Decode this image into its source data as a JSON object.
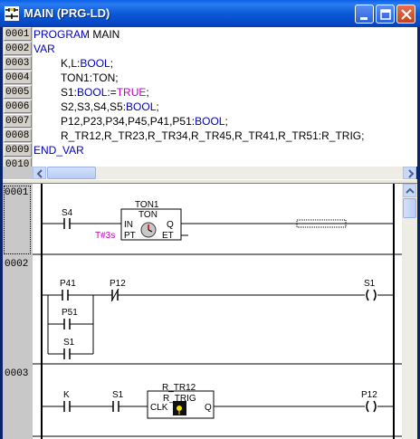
{
  "window": {
    "title": "MAIN (PRG-LD)"
  },
  "declarations": {
    "line_numbers": [
      "0001",
      "0002",
      "0003",
      "0004",
      "0005",
      "0006",
      "0007",
      "0008",
      "0009",
      "0010"
    ],
    "lines": [
      {
        "kw": "PROGRAM",
        "text": " MAIN",
        "mag": ""
      },
      {
        "kw": "VAR",
        "text": "",
        "mag": ""
      },
      {
        "kw": "",
        "text": "K,L:",
        "kw2": "BOOL",
        "tail": ";"
      },
      {
        "kw": "",
        "text": "TON1:TON;"
      },
      {
        "kw": "",
        "text": "S1:",
        "kw2": "BOOL",
        "tail": ":=",
        "mag": "TRUE",
        "tail2": ";"
      },
      {
        "kw": "",
        "text": "S2,S3,S4,S5:",
        "kw2": "BOOL",
        "tail": ";"
      },
      {
        "kw": "",
        "text": "P12,P23,P34,P45,P41,P51:",
        "kw2": "BOOL",
        "tail": ";"
      },
      {
        "kw": "",
        "text": "R_TR12,R_TR23,R_TR34,R_TR45,R_TR41,R_TR51:R_TRIG;"
      },
      {
        "kw": "END_VAR",
        "text": ""
      }
    ]
  },
  "networks": {
    "numbers": [
      "0001",
      "0002",
      "0003"
    ],
    "n1": {
      "contact": "S4",
      "block_instance": "TON1",
      "block_type": "TON",
      "in": "IN",
      "pt": "PT",
      "q": "Q",
      "et": "ET",
      "pt_value": "T#3s"
    },
    "n2": {
      "contact1": "P41",
      "contact2": "P12",
      "contact3": "P51",
      "contact4": "S1",
      "coil": "S1"
    },
    "n3": {
      "contact1": "K",
      "contact2": "S1",
      "block_instance": "R_TR12",
      "block_type": "R_TRIG",
      "clk": "CLK",
      "q": "Q",
      "coil": "P12"
    }
  },
  "colors": {
    "keyword": "#0000c0",
    "literal": "#c000c0",
    "title_bar": "#0a5ad8"
  }
}
